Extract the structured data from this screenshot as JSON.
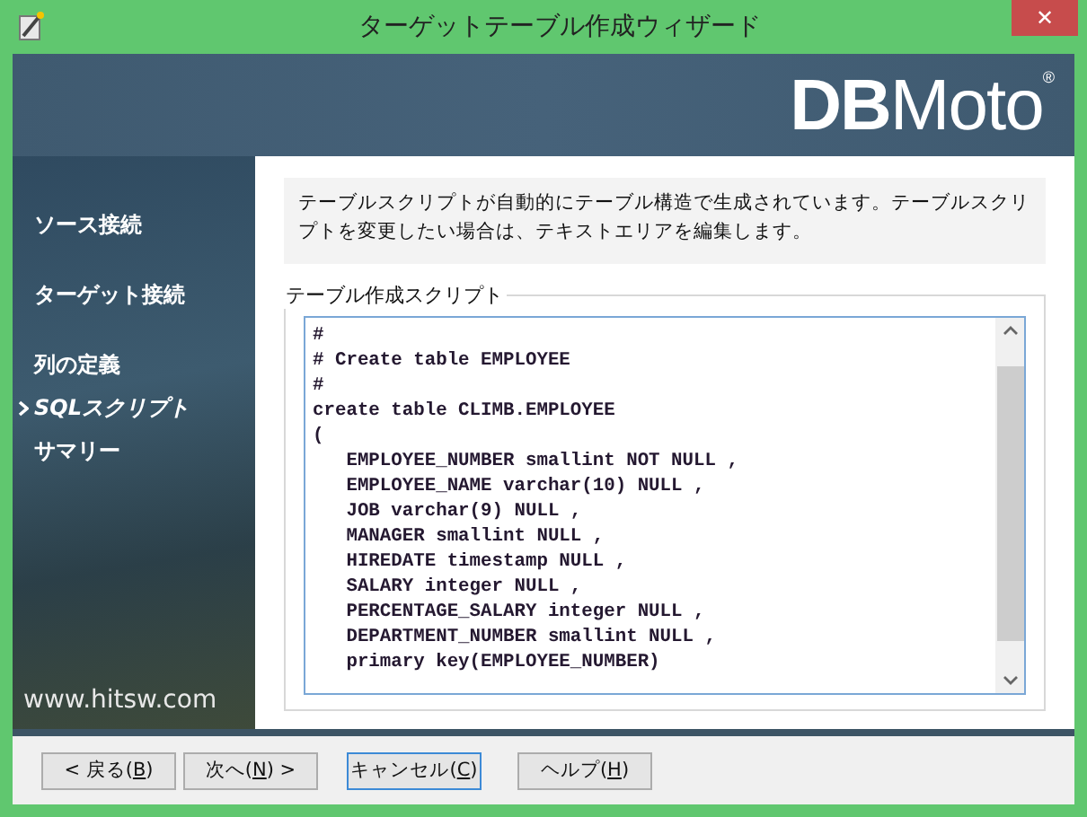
{
  "window": {
    "title": "ターゲットテーブル作成ウィザード",
    "close": "✕"
  },
  "banner": {
    "logo_bold": "DB",
    "logo_light": "Moto",
    "logo_mark": "®"
  },
  "sidebar": {
    "items": [
      {
        "label": "ソース接続",
        "selected": false
      },
      {
        "label": "ターゲット接続",
        "selected": false
      },
      {
        "label": "列の定義",
        "selected": false
      },
      {
        "label": "SQLスクリプト",
        "selected": true
      },
      {
        "label": "サマリー",
        "selected": false
      }
    ],
    "footer": "www.hitsw.com"
  },
  "info": "テーブルスクリプトが自動的にテーブル構造で生成されています。テーブルスクリプトを変更したい場合は、テキストエリアを編集します。",
  "script_group": {
    "title": "テーブル作成スクリプト",
    "value": "#\n# Create table EMPLOYEE\n#\ncreate table CLIMB.EMPLOYEE\n(\n   EMPLOYEE_NUMBER smallint NOT NULL ,\n   EMPLOYEE_NAME varchar(10) NULL ,\n   JOB varchar(9) NULL ,\n   MANAGER smallint NULL ,\n   HIREDATE timestamp NULL ,\n   SALARY integer NULL ,\n   PERCENTAGE_SALARY integer NULL ,\n   DEPARTMENT_NUMBER smallint NULL ,\n   primary key(EMPLOYEE_NUMBER)"
  },
  "buttons": [
    {
      "before": "< 戻る(",
      "mnemonic": "B",
      "after": ")",
      "focused": false
    },
    {
      "before": "次へ(",
      "mnemonic": "N",
      "after": ") >",
      "focused": false
    },
    {
      "before": "キャンセル(",
      "mnemonic": "C",
      "after": ")",
      "focused": true
    },
    {
      "before": "ヘルプ(",
      "mnemonic": "H",
      "after": ")",
      "focused": false
    }
  ]
}
